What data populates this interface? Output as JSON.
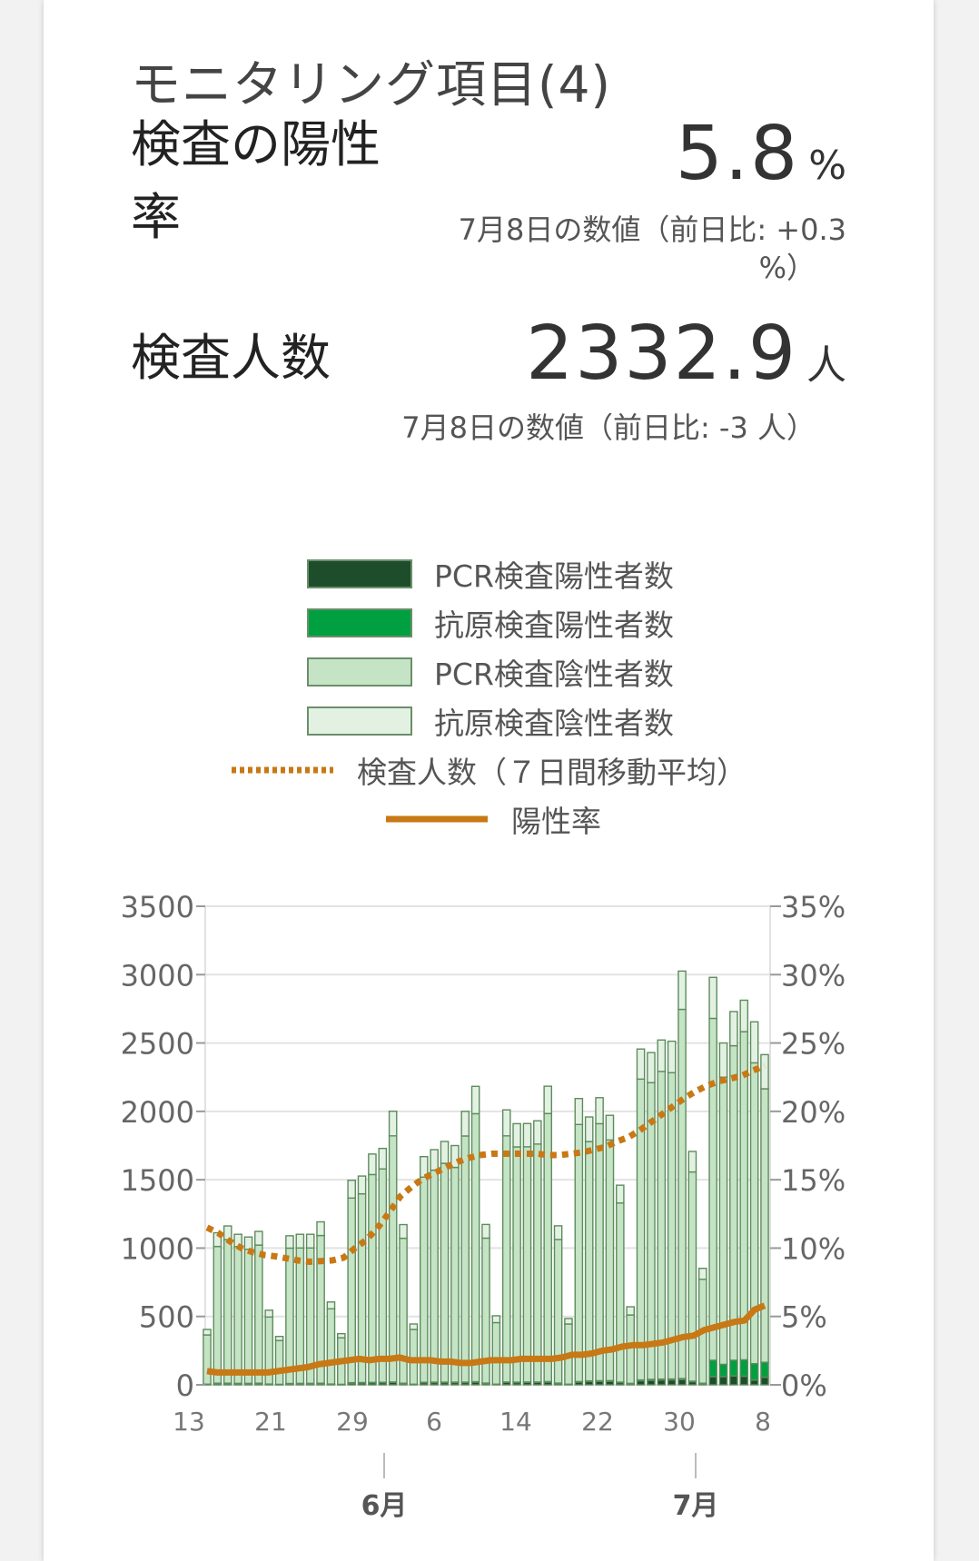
{
  "title": "モニタリング項目(4)",
  "metrics": [
    {
      "label_line1": "検査の陽性",
      "label_line2": "率",
      "value": "5.8",
      "unit": "%",
      "note_line1": "7月8日の数値（前日比: +0.3",
      "note_line2": "%）"
    },
    {
      "label": "検査人数",
      "value": "2332.9",
      "unit": "人",
      "note": "7月8日の数値（前日比: -3 人）"
    }
  ],
  "legend": [
    {
      "label": "PCR検査陽性者数",
      "color": "#1e4d2b"
    },
    {
      "label": "抗原検査陽性者数",
      "color": "#00a040"
    },
    {
      "label": "PCR検査陰性者数",
      "color": "#c5e3c5"
    },
    {
      "label": "抗原検査陰性者数",
      "color": "#e3f1e3"
    },
    {
      "label": "検査人数（７日間移動平均）",
      "color": "#c87814",
      "style": "dotted"
    },
    {
      "label": "陽性率",
      "color": "#c87814",
      "style": "solid"
    }
  ],
  "chart_data": {
    "type": "bar",
    "left_axis": {
      "min": 0,
      "max": 3500,
      "ticks": [
        "0",
        "500",
        "1000",
        "1500",
        "2000",
        "2500",
        "3000",
        "3500"
      ]
    },
    "right_axis": {
      "min": 0,
      "max": 35,
      "ticks": [
        "0%",
        "5%",
        "10%",
        "15%",
        "20%",
        "25%",
        "30%",
        "35%"
      ]
    },
    "x_tick_labels": [
      "13",
      "21",
      "29",
      "6",
      "14",
      "22",
      "30",
      "8"
    ],
    "month_labels": [
      "6月",
      "7月"
    ],
    "grid": true,
    "series": [
      {
        "name": "PCR検査陽性者数",
        "values": [
          4,
          10,
          10,
          9,
          9,
          10,
          5,
          3,
          8,
          9,
          9,
          10,
          5,
          3,
          13,
          14,
          15,
          16,
          18,
          10,
          4,
          16,
          17,
          17,
          17,
          17,
          20,
          11,
          4,
          18,
          17,
          18,
          18,
          20,
          11,
          4,
          20,
          24,
          25,
          26,
          17,
          9,
          30,
          33,
          35,
          36,
          38,
          23,
          10,
          60,
          60,
          65,
          63,
          35,
          55
        ]
      },
      {
        "name": "抗原検査陽性者数",
        "values": [
          1,
          2,
          2,
          2,
          2,
          2,
          1,
          1,
          2,
          2,
          2,
          2,
          1,
          1,
          3,
          3,
          3,
          3,
          3,
          2,
          1,
          3,
          3,
          3,
          3,
          3,
          3,
          2,
          1,
          3,
          3,
          3,
          3,
          4,
          2,
          1,
          4,
          5,
          5,
          5,
          3,
          2,
          6,
          7,
          7,
          7,
          8,
          4,
          2,
          120,
          90,
          115,
          120,
          120,
          110
        ]
      },
      {
        "name": "PCR検査陰性者数",
        "values": [
          360,
          1000,
          1050,
          1000,
          980,
          1010,
          490,
          320,
          990,
          990,
          990,
          1080,
          550,
          340,
          1350,
          1380,
          1520,
          1560,
          1800,
          1060,
          400,
          1500,
          1550,
          1600,
          1570,
          1800,
          1960,
          1060,
          450,
          1800,
          1720,
          1720,
          1740,
          1960,
          1050,
          440,
          1880,
          1750,
          1880,
          1760,
          1310,
          500,
          2200,
          2170,
          2250,
          2240,
          2700,
          1530,
          760,
          2500,
          2100,
          2300,
          2400,
          2200,
          2000
        ]
      },
      {
        "name": "抗原検査陰性者数",
        "values": [
          40,
          100,
          100,
          90,
          90,
          100,
          50,
          30,
          90,
          100,
          100,
          100,
          50,
          30,
          130,
          130,
          150,
          150,
          180,
          100,
          40,
          150,
          150,
          160,
          160,
          180,
          200,
          100,
          50,
          190,
          170,
          170,
          170,
          200,
          100,
          40,
          190,
          180,
          190,
          180,
          130,
          60,
          220,
          220,
          230,
          230,
          280,
          150,
          80,
          300,
          250,
          250,
          230,
          300,
          250
        ]
      },
      {
        "name": "検査人数（７日間移動平均）",
        "values": [
          1150,
          1110,
          1050,
          1000,
          970,
          950,
          940,
          925,
          910,
          900,
          905,
          910,
          930,
          1000,
          1060,
          1150,
          1260,
          1380,
          1450,
          1510,
          1550,
          1590,
          1630,
          1660,
          1680,
          1690,
          1690,
          1690,
          1690,
          1690,
          1680,
          1680,
          1690,
          1700,
          1720,
          1740,
          1780,
          1810,
          1860,
          1920,
          1980,
          2040,
          2100,
          2150,
          2190,
          2220,
          2240,
          2260,
          2300,
          2332.9
        ]
      },
      {
        "name": "陽性率",
        "values": [
          1.0,
          0.9,
          0.9,
          0.9,
          0.9,
          0.9,
          0.9,
          1.0,
          1.1,
          1.2,
          1.3,
          1.5,
          1.6,
          1.7,
          1.8,
          1.9,
          1.8,
          1.9,
          1.9,
          2.0,
          1.8,
          1.8,
          1.8,
          1.7,
          1.7,
          1.6,
          1.6,
          1.7,
          1.8,
          1.8,
          1.8,
          1.9,
          1.9,
          1.9,
          1.9,
          2.0,
          2.2,
          2.2,
          2.3,
          2.5,
          2.6,
          2.8,
          2.9,
          2.9,
          3.0,
          3.1,
          3.3,
          3.5,
          3.6,
          4.0,
          4.2,
          4.4,
          4.6,
          4.7,
          5.5,
          5.8
        ]
      }
    ]
  }
}
